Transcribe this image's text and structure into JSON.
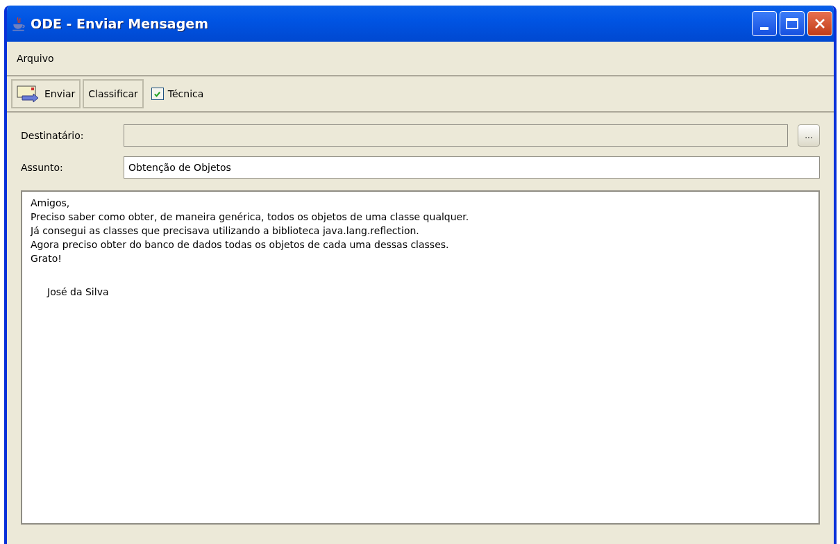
{
  "window": {
    "title": "ODE - Enviar Mensagem"
  },
  "menu": [
    {
      "label": "Arquivo"
    }
  ],
  "toolbar": {
    "buttons": [
      {
        "kind": "icon",
        "label": "Enviar"
      },
      {
        "kind": "plain",
        "label": "Classificar"
      }
    ],
    "checkbox": {
      "label": "Técnica",
      "checked": true
    }
  },
  "fields": [
    {
      "label": "Destinatário:",
      "disabled": true,
      "browse": "..."
    },
    {
      "label": "Assunto:",
      "value": "Obtenção de Objetos",
      "disabled": false
    }
  ],
  "message": {
    "lines": [
      {
        "text": "Amigos,",
        "indented": false
      },
      {
        "text": "Preciso saber como obter, de maneira genérica, todos os objetos de uma classe qualquer.",
        "indented": false
      },
      {
        "text": "Já consegui as classes que precisava utilizando a biblioteca java.lang.reflection.",
        "indented": false
      },
      {
        "text": "Agora preciso obter do banco de dados todas os objetos de cada uma dessas classes.",
        "indented": false
      },
      {
        "text": "Grato!",
        "indented": false
      },
      {
        "text": "José da Silva",
        "indented": true
      }
    ]
  }
}
